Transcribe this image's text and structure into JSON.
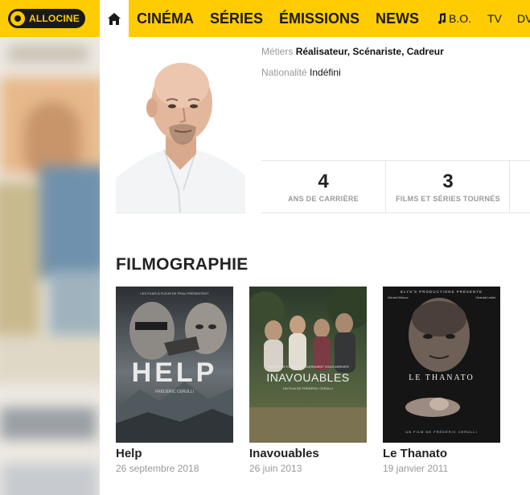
{
  "nav": {
    "logo": "ALLOCINE",
    "items": [
      "CINÉMA",
      "SÉRIES",
      "ÉMISSIONS",
      "NEWS"
    ],
    "small_items": [
      "B.O.",
      "TV",
      "DV"
    ]
  },
  "profile": {
    "jobs_label": "Métiers",
    "jobs_value": "Réalisateur, Scénariste, Cadreur",
    "nationality_label": "Nationalité",
    "nationality_value": "Indéfini"
  },
  "stats": [
    {
      "value": "4",
      "label": "ANS DE CARRIÈRE"
    },
    {
      "value": "3",
      "label": "FILMS ET SÉRIES TOURNÉS"
    }
  ],
  "filmography": {
    "title": "FILMOGRAPHIE",
    "films": [
      {
        "title": "Help",
        "date": "26 septembre 2018",
        "poster_text": "HELP",
        "poster_top": "LES FILMS À FLEUR DE PEAU PRÉSENTENT",
        "poster_bottom": "FRÉDÉRIC CERULLI"
      },
      {
        "title": "Inavouables",
        "date": "26 juin 2013",
        "poster_text": "INAVOUABLES",
        "poster_top": "INSPIRÉ DE FAITS QUI POURRAIENT VOUS ARRIVER",
        "poster_bottom": "UN FILM DE FRÉDÉRIC CERULLI"
      },
      {
        "title": "Le Thanato",
        "date": "19 janvier 2011",
        "poster_text": "LE THANATO",
        "poster_top": "ELYS'S PRODUCTIONS PRÉSENTE",
        "poster_names": [
          "Gérard Miroux",
          "Chantal Ladet"
        ],
        "poster_bottom": "UN FILM DE FRÉDÉRIC CERULLI"
      }
    ]
  },
  "colors": {
    "brand_yellow": "#fecc00",
    "text_dark": "#222222",
    "text_muted": "#999999"
  }
}
